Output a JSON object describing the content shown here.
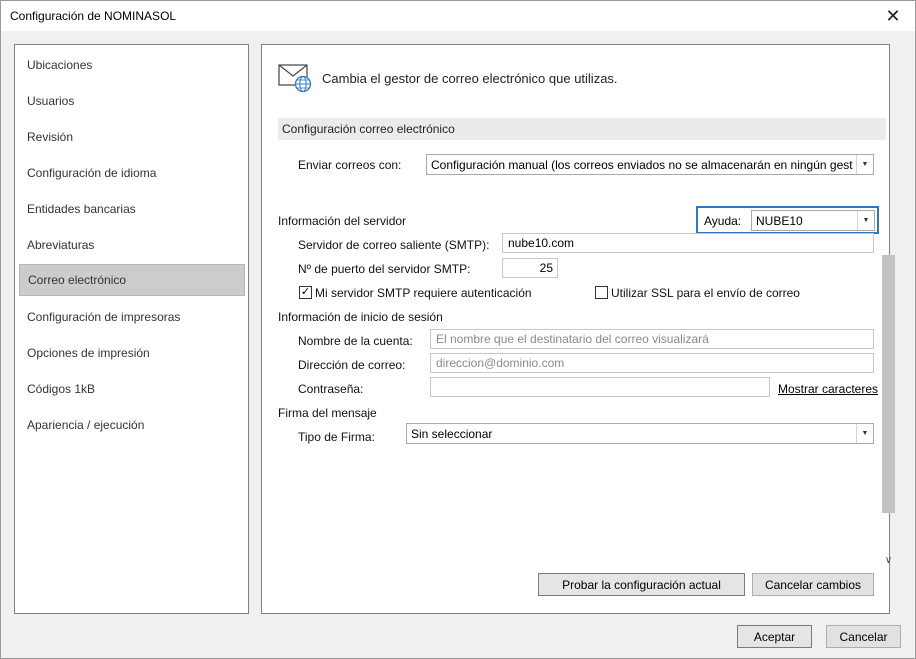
{
  "window": {
    "title": "Configuración de NOMINASOL",
    "close_glyph": "✕"
  },
  "sidebar": {
    "items": [
      {
        "label": "Ubicaciones"
      },
      {
        "label": "Usuarios"
      },
      {
        "label": "Revisión"
      },
      {
        "label": "Configuración de idioma"
      },
      {
        "label": "Entidades bancarias"
      },
      {
        "label": "Abreviaturas"
      },
      {
        "label": "Correo electrónico",
        "selected": true
      },
      {
        "label": "Configuración de impresoras"
      },
      {
        "label": "Opciones de impresión"
      },
      {
        "label": "Códigos 1kB"
      },
      {
        "label": "Apariencia / ejecución"
      }
    ]
  },
  "content": {
    "header_icon": "mail-globe-icon",
    "header_text": "Cambia el gestor de correo electrónico que utilizas.",
    "section_title": "Configuración correo electrónico",
    "send_with": {
      "label": "Enviar correos con:",
      "value": "Configuración manual (los correos enviados no se almacenarán en ningún gestor de correo)"
    },
    "server_info": {
      "title": "Información del servidor",
      "help_label": "Ayuda:",
      "help_value": "NUBE10",
      "smtp_label": "Servidor de correo saliente (SMTP):",
      "smtp_value": "nube10.com",
      "port_label": "Nº de puerto del servidor SMTP:",
      "port_value": "25",
      "auth_label": "Mi servidor SMTP requiere autenticación",
      "auth_checked": true,
      "ssl_label": "Utilizar SSL para el envío de correo",
      "ssl_checked": false
    },
    "login_info": {
      "title": "Información de inicio de sesión",
      "account_label": "Nombre de la cuenta:",
      "account_placeholder": "El nombre que el destinatario del correo visualizará",
      "email_label": "Dirección de correo:",
      "email_placeholder": "direccion@dominio.com",
      "password_label": "Contraseña:",
      "password_value": "",
      "show_chars_link": "Mostrar caracteres"
    },
    "signature": {
      "title": "Firma del mensaje",
      "type_label": "Tipo de Firma:",
      "type_value": "Sin seleccionar"
    },
    "buttons": {
      "test": "Probar la configuración actual",
      "cancel_changes": "Cancelar cambios"
    }
  },
  "footer": {
    "accept": "Aceptar",
    "cancel": "Cancelar"
  },
  "colors": {
    "accent": "#2b79c5",
    "selected_nav": "#cccccc"
  }
}
